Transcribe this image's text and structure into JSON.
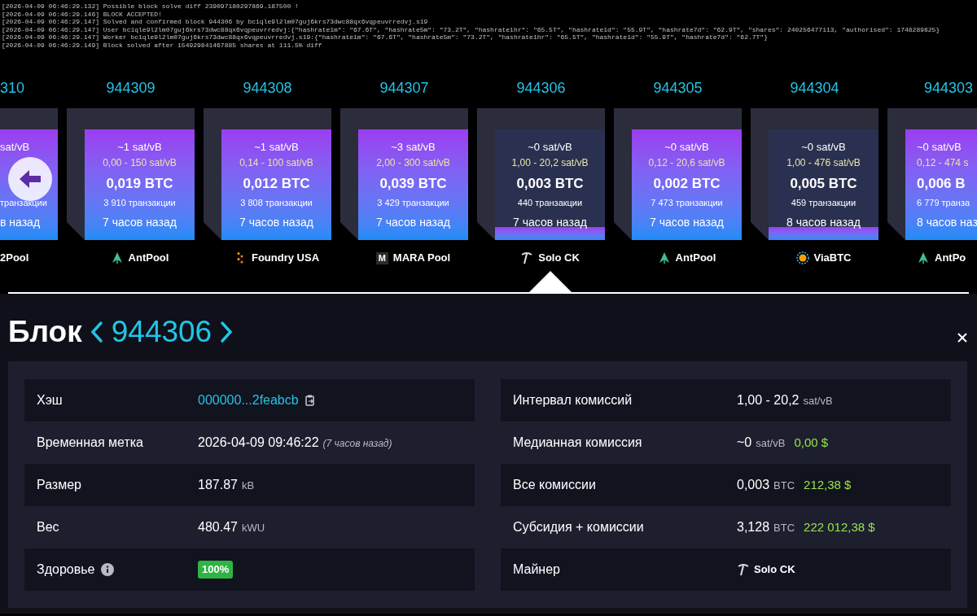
{
  "log": [
    "[2026-04-09 06:46:29.132] Possible block solve diff 239097180297869.187500 !",
    "[2026-04-09 06:46:29.146] BLOCK ACCEPTED!",
    "[2026-04-09 06:46:29.147] Solved and confirmed block 944306 by bc1qle9l2lm07guj6krs73dwc88qx6vqpeuvrredvj.s19",
    "[2026-04-09 06:46:29.147] User bc1qle9l2lm07guj6krs73dwc88qx6vqpeuvrredvj:{\"hashrate1m\": \"67.6T\", \"hashrate5m\": \"73.2T\", \"hashrate1hr\": \"65.5T\", \"hashrate1d\": \"55.9T\", \"hashrate7d\": \"62.9T\", \"shares\": 240256477113, \"authorised\": 1748289825}",
    "[2026-04-09 06:46:29.147] Worker bc1qle9l2lm07guj6krs73dwc88qx6vqpeuvrredvj.s19:{\"hashrate1m\": \"67.6T\", \"hashrate5m\": \"73.2T\", \"hashrate1hr\": \"65.5T\", \"hashrate1d\": \"55.9T\", \"hashrate7d\": \"62.7T\"}",
    "[2026-04-09 06:46:29.149] Block solved after 154929841467885 shares at 111.5% diff"
  ],
  "blocks": [
    {
      "kind": "cut_left",
      "number": "310",
      "fee": "sat/vB",
      "transactions": "транзакции",
      "time": "в назад",
      "level": 1,
      "selected": false,
      "pool": {
        "name": "2Pool",
        "kind": "none"
      }
    },
    {
      "kind": "full",
      "number": "944309",
      "fee": "~1 sat/vB",
      "range": "0,00 - 150 sat/vB",
      "total": "0,019 BTC",
      "transactions": "3 910 транзакции",
      "time": "7 часов назад",
      "level": 1,
      "selected": false,
      "pool": {
        "name": "AntPool",
        "kind": "arrow"
      }
    },
    {
      "kind": "full",
      "number": "944308",
      "fee": "~1 sat/vB",
      "range": "0,14 - 100 sat/vB",
      "total": "0,012 BTC",
      "transactions": "3 808 транзакции",
      "time": "7 часов назад",
      "level": 1,
      "selected": false,
      "pool": {
        "name": "Foundry USA",
        "kind": "dots"
      }
    },
    {
      "kind": "full",
      "number": "944307",
      "fee": "~3 sat/vB",
      "range": "2,00 - 300 sat/vB",
      "total": "0,039 BTC",
      "transactions": "3 429 транзакции",
      "time": "7 часов назад",
      "level": 1,
      "selected": false,
      "pool": {
        "name": "MARA Pool",
        "kind": "tile",
        "logo_text": "M"
      }
    },
    {
      "kind": "full",
      "number": "944306",
      "fee": "~0 sat/vB",
      "range": "1,00 - 20,2 sat/vB",
      "total": "0,003 BTC",
      "transactions": "440 транзакции",
      "time": "7 часов назад",
      "level": 0.12,
      "selected": true,
      "pool": {
        "name": "Solo CK",
        "kind": "pickaxe"
      }
    },
    {
      "kind": "full",
      "number": "944305",
      "fee": "~0 sat/vB",
      "range": "0,12 - 20,6 sat/vB",
      "total": "0,002 BTC",
      "transactions": "7 473 транзакции",
      "time": "7 часов назад",
      "level": 1,
      "selected": false,
      "pool": {
        "name": "AntPool",
        "kind": "arrow"
      }
    },
    {
      "kind": "full",
      "number": "944304",
      "fee": "~0 sat/vB",
      "range": "1,00 - 476 sat/vB",
      "total": "0,005 BTC",
      "transactions": "459 транзакции",
      "time": "8 часов назад",
      "level": 0.12,
      "selected": false,
      "pool": {
        "name": "ViaBTC",
        "kind": "coin"
      }
    },
    {
      "kind": "cut_right",
      "number": "944303",
      "fee": "~0 sat/vB",
      "range": "0,12 - 474 s",
      "total": "0,006 B",
      "transactions": "6 779 транза",
      "time": "8 часов наз",
      "level": 1,
      "selected": false,
      "pool": {
        "name": "AntPo",
        "kind": "arrow"
      }
    }
  ],
  "heading": {
    "title": "Блок",
    "number": "944306"
  },
  "details": {
    "left": [
      {
        "label": "Хэш",
        "kind": "hash",
        "value": "000000...2feabcb"
      },
      {
        "label": "Временная метка",
        "kind": "time",
        "value": "2026-04-09 09:46:22",
        "note": "(7 часов назад)"
      },
      {
        "label": "Размер",
        "kind": "amount",
        "value": "187.87",
        "unit": "kB"
      },
      {
        "label": "Вес",
        "kind": "amount",
        "value": "480.47",
        "unit": "kWU"
      },
      {
        "label": "Здоровье",
        "kind": "health",
        "value": "100%"
      }
    ],
    "right": [
      {
        "label": "Интервал комиссий",
        "kind": "amount",
        "value": "1,00 - 20,2",
        "unit": "sat/vB"
      },
      {
        "label": "Медианная комиссия",
        "kind": "amount",
        "value": "~0",
        "unit": "sat/vB",
        "fiat": "0,00 $"
      },
      {
        "label": "Все комиссии",
        "kind": "amount",
        "value": "0,003",
        "unit": "BTC",
        "fiat": "212,38 $"
      },
      {
        "label": "Субсидия + комиссии",
        "kind": "amount",
        "value": "3,128",
        "unit": "BTC",
        "fiat": "222 012,38 $"
      },
      {
        "label": "Майнер",
        "kind": "miner",
        "value": "Solo CK"
      }
    ]
  }
}
